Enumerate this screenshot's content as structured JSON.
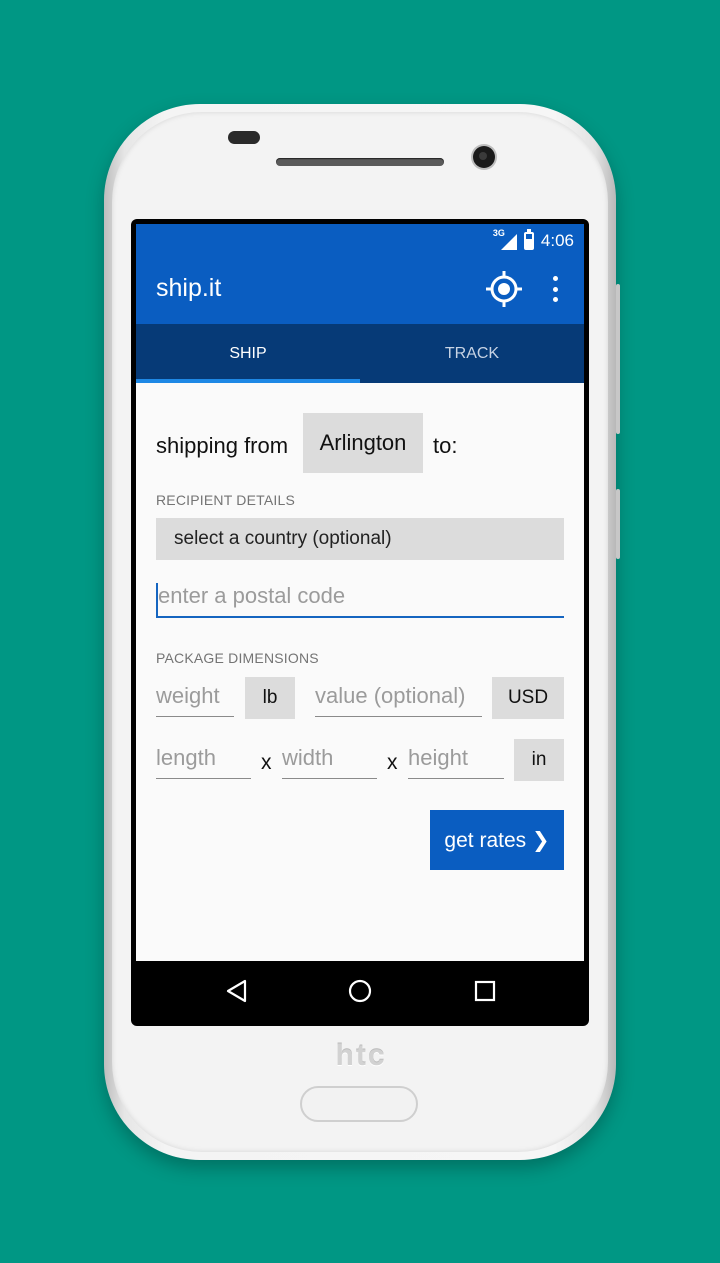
{
  "status": {
    "network": "3G",
    "time": "4:06"
  },
  "appbar": {
    "title": "ship.it",
    "locate_icon": "gps-locate-icon",
    "menu_icon": "more-vert-icon"
  },
  "tabs": [
    {
      "label": "SHIP",
      "active": true
    },
    {
      "label": "TRACK",
      "active": false
    }
  ],
  "form": {
    "shipping_from_label": "shipping from",
    "origin_city": "Arlington",
    "to_label": "to:",
    "recipient_header": "RECIPIENT DETAILS",
    "country_select": "select a country (optional)",
    "postal_placeholder": "enter a postal code",
    "package_header": "PACKAGE DIMENSIONS",
    "weight_placeholder": "weight",
    "weight_unit": "lb",
    "value_placeholder": "value (optional)",
    "currency": "USD",
    "length_placeholder": "length",
    "times_1": "x",
    "width_placeholder": "width",
    "times_2": "x",
    "height_placeholder": "height",
    "dim_unit": "in",
    "submit_label": "get rates ❯"
  },
  "navbar": {
    "back_icon": "back-triangle-icon",
    "home_icon": "home-circle-icon",
    "recents_icon": "recents-square-icon"
  },
  "device": {
    "brand": "htc"
  },
  "colors": {
    "background": "#009784",
    "primary": "#0a5dc1",
    "tab_bar": "#063a77",
    "accent": "#1e88e5"
  }
}
